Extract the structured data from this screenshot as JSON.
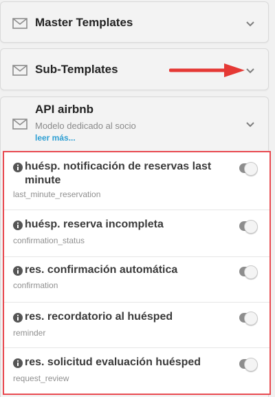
{
  "accordions": [
    {
      "title": "Master Templates",
      "icon": "mail-icon",
      "chevron": "chevron-down-icon"
    },
    {
      "title": "Sub-Templates",
      "icon": "mail-icon",
      "chevron": "chevron-down-icon"
    },
    {
      "title": "API airbnb",
      "description": "Modelo dedicado al socio",
      "more": "leer más...",
      "icon": "mail-icon",
      "chevron": "chevron-down-icon"
    }
  ],
  "annotation": {
    "arrow_color": "#e53935"
  },
  "templates": [
    {
      "title": "huésp. notificación de reservas last minute",
      "key": "last_minute_reservation",
      "enabled": true
    },
    {
      "title": "huésp. reserva incompleta",
      "key": "confirmation_status",
      "enabled": true
    },
    {
      "title": "res. confirmación automática",
      "key": "confirmation",
      "enabled": true
    },
    {
      "title": "res. recordatorio al huésped",
      "key": "reminder",
      "enabled": true
    },
    {
      "title": "res. solicitud evaluación huésped",
      "key": "request_review",
      "enabled": true
    }
  ],
  "colors": {
    "highlight_border": "#e8484f",
    "link": "#2e9fd3",
    "toggle_track": "#8d8d8d"
  }
}
